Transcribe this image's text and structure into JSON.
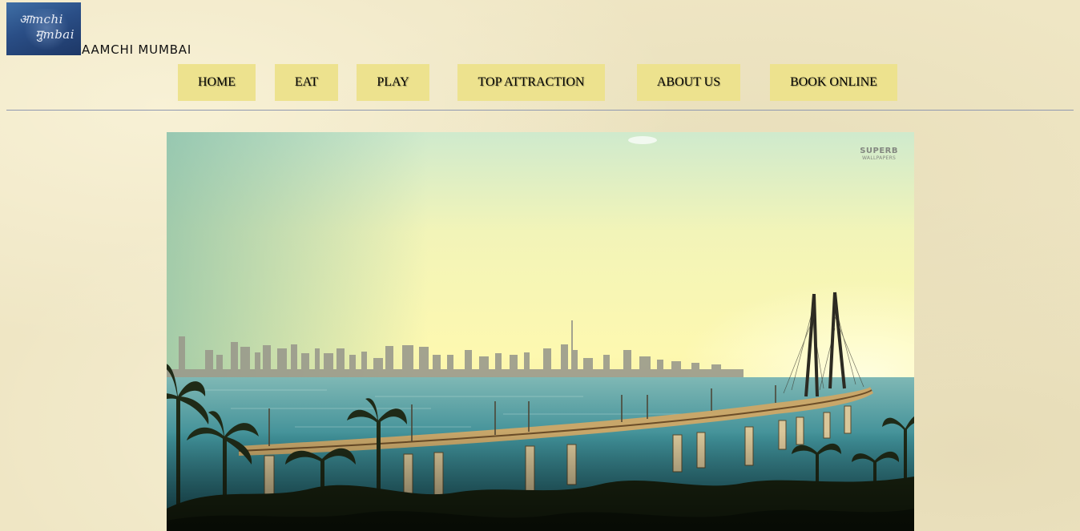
{
  "header": {
    "logo_line1": "आmchi",
    "logo_line2": "मुmbai",
    "site_title": "AAMCHI MUMBAI"
  },
  "nav": {
    "items": [
      {
        "label": "HOME"
      },
      {
        "label": "EAT"
      },
      {
        "label": "PLAY"
      },
      {
        "label": "TOP ATTRACTION"
      },
      {
        "label": "ABOUT US"
      },
      {
        "label": "BOOK ONLINE"
      }
    ],
    "button_color": "#ede28e"
  },
  "hero": {
    "description_visible": false,
    "watermark_line1": "SUPERB",
    "watermark_line2": "WALLPAPERS"
  },
  "colors": {
    "page_background": "#efe6c4",
    "divider": "#8f98b0"
  }
}
